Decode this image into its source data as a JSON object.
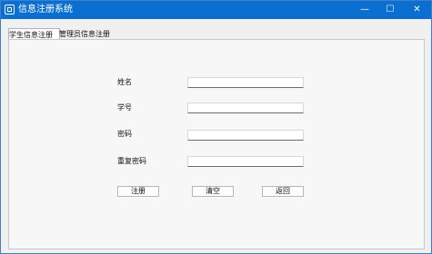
{
  "window": {
    "title": "信息注册系统",
    "controls": {
      "minimize": "—",
      "maximize": "☐",
      "close": "✕"
    }
  },
  "tabs": [
    "学生信息注册",
    "管理员信息注册"
  ],
  "form": {
    "name_label": "姓名",
    "id_label": "学号",
    "password_label": "密码",
    "confirm_label": "重复密码",
    "name_value": "",
    "id_value": "",
    "password_value": "",
    "confirm_value": ""
  },
  "buttons": {
    "register": "注册",
    "clear": "清空",
    "back": "返回"
  },
  "colors": {
    "titlebar": "#0a6fd1",
    "accent": "#3f7fc8"
  }
}
